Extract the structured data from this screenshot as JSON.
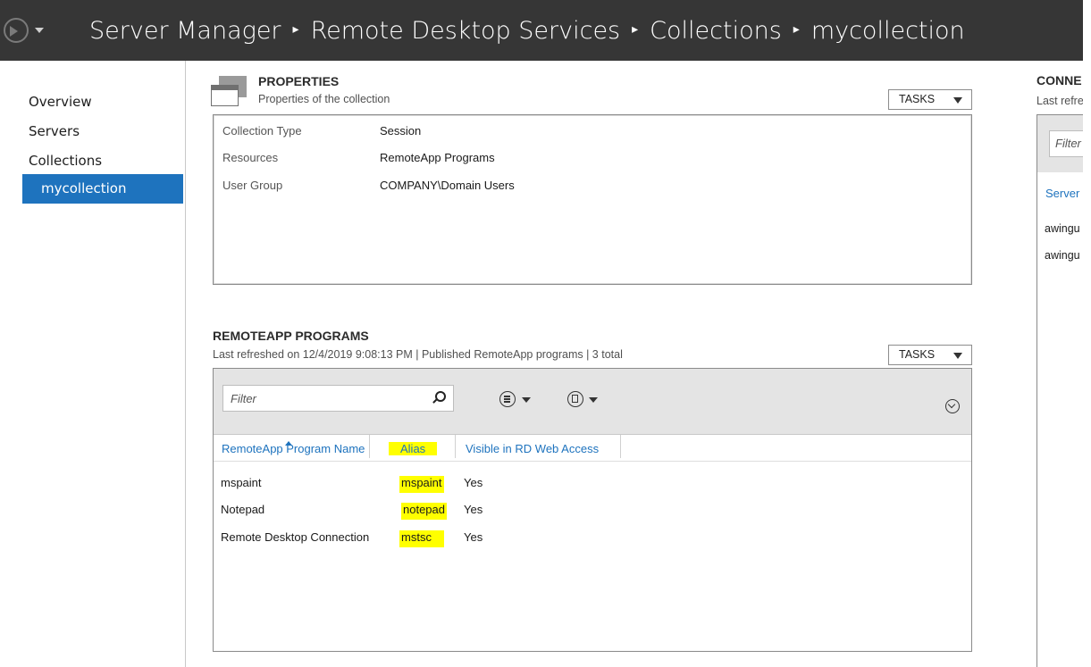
{
  "titlebar": {
    "breadcrumb": [
      "Server Manager",
      "Remote Desktop Services",
      "Collections",
      "mycollection"
    ],
    "separator": "▸"
  },
  "leftnav": {
    "items": [
      "Overview",
      "Servers",
      "Collections"
    ],
    "selected": "mycollection"
  },
  "properties": {
    "title": "PROPERTIES",
    "subtitle": "Properties of the collection",
    "tasks_label": "TASKS",
    "rows": [
      {
        "label": "Collection Type",
        "value": "Session"
      },
      {
        "label": "Resources",
        "value": "RemoteApp Programs"
      },
      {
        "label": "User Group",
        "value": "COMPANY\\Domain Users"
      }
    ]
  },
  "remoteapp": {
    "title": "REMOTEAPP PROGRAMS",
    "subtitle": "Last refreshed on 12/4/2019 9:08:13 PM | Published RemoteApp programs  | 3 total",
    "tasks_label": "TASKS",
    "filter_placeholder": "Filter",
    "columns": [
      "RemoteApp Program Name",
      "Alias",
      "Visible in RD Web Access"
    ],
    "rows": [
      {
        "name": "mspaint",
        "alias": "mspaint",
        "visible": "Yes"
      },
      {
        "name": "Notepad",
        "alias": "notepad",
        "visible": "Yes"
      },
      {
        "name": "Remote Desktop Connection",
        "alias": "mstsc",
        "visible": "Yes"
      }
    ],
    "highlight_color": "#ffff00"
  },
  "connections": {
    "title": "CONNE",
    "subtitle": "Last refre",
    "filter_placeholder": "Filter",
    "column": "Server",
    "rows": [
      "awingu",
      "awingu"
    ]
  },
  "colors": {
    "titlebar_bg": "#363636",
    "accent": "#1e73be",
    "toolbar_bg": "#e4e4e4"
  }
}
